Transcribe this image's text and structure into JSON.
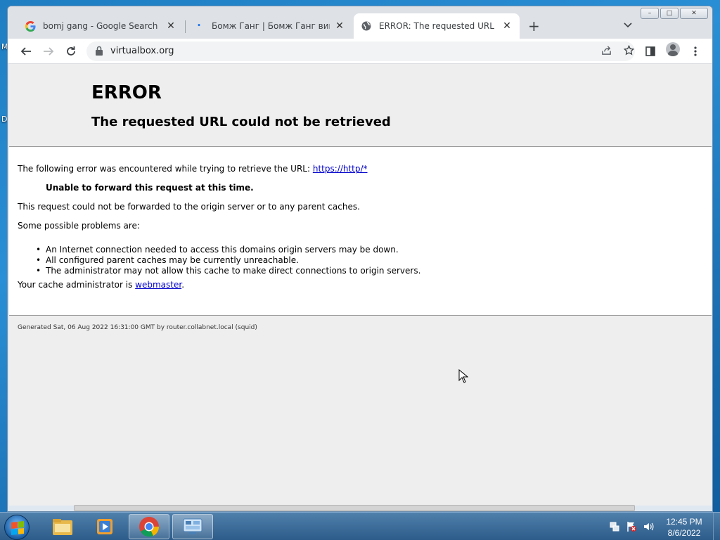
{
  "desktop": {
    "edge_glyphs": [
      "M",
      "D"
    ]
  },
  "browser": {
    "tabs": [
      {
        "title": "bomj gang - Google Search",
        "active": false
      },
      {
        "title": "Бомж Ганг | Бомж Ганг вики | Fa",
        "active": false
      },
      {
        "title": "ERROR: The requested URL could",
        "active": true
      }
    ],
    "window_controls": {
      "minimize": "–",
      "maximize": "□",
      "close": "✕"
    },
    "address": "virtualbox.org"
  },
  "page": {
    "heading": "ERROR",
    "subheading": "The requested URL could not be retrieved",
    "intro": "The following error was encountered while trying to retrieve the URL: ",
    "intro_link": "https://http/*",
    "error_title": "Unable to forward this request at this time.",
    "explanation": "This request could not be forwarded to the origin server or to any parent caches.",
    "problems_intro": "Some possible problems are:",
    "problems": [
      "An Internet connection needed to access this domains origin servers may be down.",
      "All configured parent caches may be currently unreachable.",
      "The administrator may not allow this cache to make direct connections to origin servers."
    ],
    "admin_prefix": "Your cache administrator is ",
    "admin_link": "webmaster",
    "admin_suffix": ".",
    "footer": "Generated Sat, 06 Aug 2022 16:31:00 GMT by router.collabnet.local (squid)"
  },
  "taskbar": {
    "apps": [
      "explorer-icon",
      "media-player-icon",
      "chrome-icon",
      "control-panel-icon"
    ],
    "active_app": "chrome-icon",
    "time": "12:45 PM",
    "date": "8/6/2022"
  }
}
